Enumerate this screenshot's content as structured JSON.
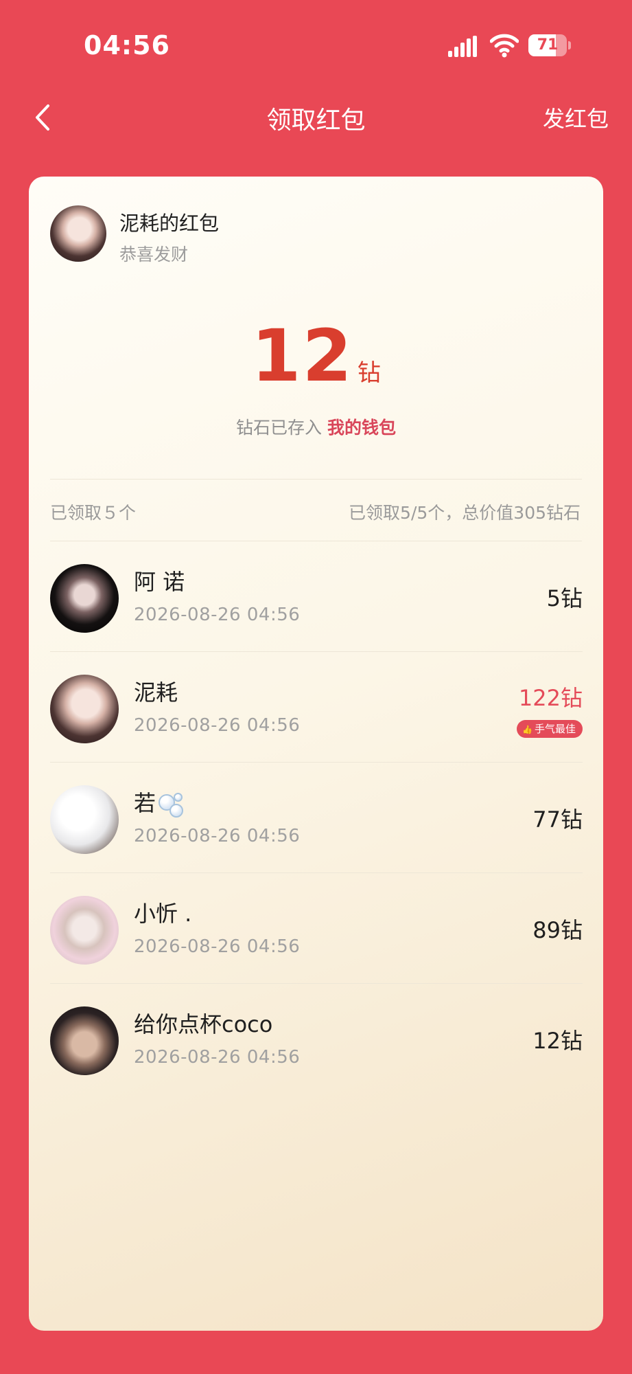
{
  "status": {
    "time": "04:56",
    "battery": "71",
    "battery_level": 0.71
  },
  "nav": {
    "title": "领取红包",
    "action": "发红包"
  },
  "owner": {
    "name": "泥耗的红包",
    "subtitle": "恭喜发财"
  },
  "amount": {
    "value": "12",
    "unit": "钻"
  },
  "wallet": {
    "prefix": "钻石已存入",
    "link": "我的钱包"
  },
  "stats": {
    "left": "已领取５个",
    "right": "已领取5/5个，总价值305钻石"
  },
  "best_badge": "手气最佳",
  "records": [
    {
      "name": "阿 诺",
      "date": "2026-08-26 04:56",
      "value": "5钻",
      "best": false
    },
    {
      "name": "泥耗",
      "date": "2026-08-26 04:56",
      "value": "122钻",
      "best": true
    },
    {
      "name": "若",
      "date": "2026-08-26 04:56",
      "value": "77钻",
      "best": false
    },
    {
      "name": "小忻 .",
      "date": "2026-08-26 04:56",
      "value": "89钻",
      "best": false
    },
    {
      "name": "给你点杯coco",
      "date": "2026-08-26 04:56",
      "value": "12钻",
      "best": false
    }
  ],
  "colors": {
    "background": "#e94855",
    "accent": "#d93e2e",
    "best": "#e44b59"
  }
}
